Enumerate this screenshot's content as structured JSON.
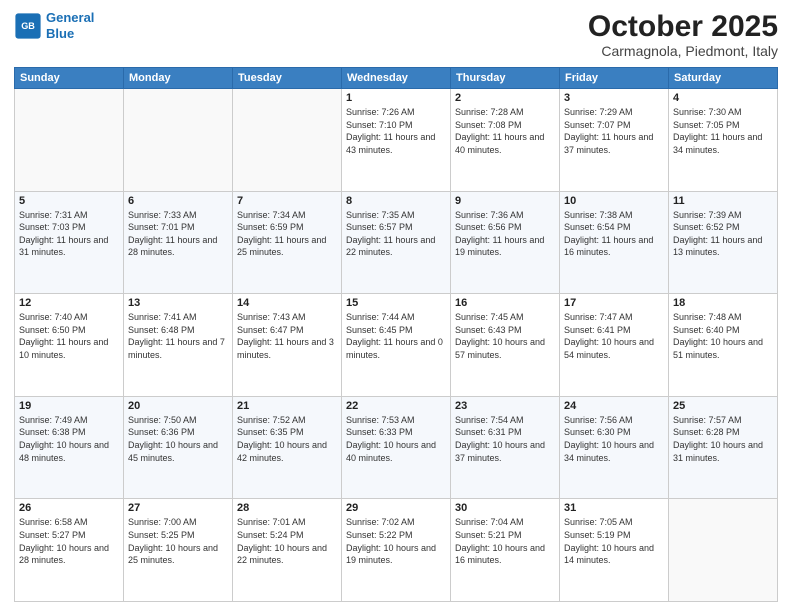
{
  "header": {
    "logo_line1": "General",
    "logo_line2": "Blue",
    "month": "October 2025",
    "location": "Carmagnola, Piedmont, Italy"
  },
  "days_of_week": [
    "Sunday",
    "Monday",
    "Tuesday",
    "Wednesday",
    "Thursday",
    "Friday",
    "Saturday"
  ],
  "weeks": [
    [
      {
        "day": "",
        "content": ""
      },
      {
        "day": "",
        "content": ""
      },
      {
        "day": "",
        "content": ""
      },
      {
        "day": "1",
        "content": "Sunrise: 7:26 AM\nSunset: 7:10 PM\nDaylight: 11 hours and 43 minutes."
      },
      {
        "day": "2",
        "content": "Sunrise: 7:28 AM\nSunset: 7:08 PM\nDaylight: 11 hours and 40 minutes."
      },
      {
        "day": "3",
        "content": "Sunrise: 7:29 AM\nSunset: 7:07 PM\nDaylight: 11 hours and 37 minutes."
      },
      {
        "day": "4",
        "content": "Sunrise: 7:30 AM\nSunset: 7:05 PM\nDaylight: 11 hours and 34 minutes."
      }
    ],
    [
      {
        "day": "5",
        "content": "Sunrise: 7:31 AM\nSunset: 7:03 PM\nDaylight: 11 hours and 31 minutes."
      },
      {
        "day": "6",
        "content": "Sunrise: 7:33 AM\nSunset: 7:01 PM\nDaylight: 11 hours and 28 minutes."
      },
      {
        "day": "7",
        "content": "Sunrise: 7:34 AM\nSunset: 6:59 PM\nDaylight: 11 hours and 25 minutes."
      },
      {
        "day": "8",
        "content": "Sunrise: 7:35 AM\nSunset: 6:57 PM\nDaylight: 11 hours and 22 minutes."
      },
      {
        "day": "9",
        "content": "Sunrise: 7:36 AM\nSunset: 6:56 PM\nDaylight: 11 hours and 19 minutes."
      },
      {
        "day": "10",
        "content": "Sunrise: 7:38 AM\nSunset: 6:54 PM\nDaylight: 11 hours and 16 minutes."
      },
      {
        "day": "11",
        "content": "Sunrise: 7:39 AM\nSunset: 6:52 PM\nDaylight: 11 hours and 13 minutes."
      }
    ],
    [
      {
        "day": "12",
        "content": "Sunrise: 7:40 AM\nSunset: 6:50 PM\nDaylight: 11 hours and 10 minutes."
      },
      {
        "day": "13",
        "content": "Sunrise: 7:41 AM\nSunset: 6:48 PM\nDaylight: 11 hours and 7 minutes."
      },
      {
        "day": "14",
        "content": "Sunrise: 7:43 AM\nSunset: 6:47 PM\nDaylight: 11 hours and 3 minutes."
      },
      {
        "day": "15",
        "content": "Sunrise: 7:44 AM\nSunset: 6:45 PM\nDaylight: 11 hours and 0 minutes."
      },
      {
        "day": "16",
        "content": "Sunrise: 7:45 AM\nSunset: 6:43 PM\nDaylight: 10 hours and 57 minutes."
      },
      {
        "day": "17",
        "content": "Sunrise: 7:47 AM\nSunset: 6:41 PM\nDaylight: 10 hours and 54 minutes."
      },
      {
        "day": "18",
        "content": "Sunrise: 7:48 AM\nSunset: 6:40 PM\nDaylight: 10 hours and 51 minutes."
      }
    ],
    [
      {
        "day": "19",
        "content": "Sunrise: 7:49 AM\nSunset: 6:38 PM\nDaylight: 10 hours and 48 minutes."
      },
      {
        "day": "20",
        "content": "Sunrise: 7:50 AM\nSunset: 6:36 PM\nDaylight: 10 hours and 45 minutes."
      },
      {
        "day": "21",
        "content": "Sunrise: 7:52 AM\nSunset: 6:35 PM\nDaylight: 10 hours and 42 minutes."
      },
      {
        "day": "22",
        "content": "Sunrise: 7:53 AM\nSunset: 6:33 PM\nDaylight: 10 hours and 40 minutes."
      },
      {
        "day": "23",
        "content": "Sunrise: 7:54 AM\nSunset: 6:31 PM\nDaylight: 10 hours and 37 minutes."
      },
      {
        "day": "24",
        "content": "Sunrise: 7:56 AM\nSunset: 6:30 PM\nDaylight: 10 hours and 34 minutes."
      },
      {
        "day": "25",
        "content": "Sunrise: 7:57 AM\nSunset: 6:28 PM\nDaylight: 10 hours and 31 minutes."
      }
    ],
    [
      {
        "day": "26",
        "content": "Sunrise: 6:58 AM\nSunset: 5:27 PM\nDaylight: 10 hours and 28 minutes."
      },
      {
        "day": "27",
        "content": "Sunrise: 7:00 AM\nSunset: 5:25 PM\nDaylight: 10 hours and 25 minutes."
      },
      {
        "day": "28",
        "content": "Sunrise: 7:01 AM\nSunset: 5:24 PM\nDaylight: 10 hours and 22 minutes."
      },
      {
        "day": "29",
        "content": "Sunrise: 7:02 AM\nSunset: 5:22 PM\nDaylight: 10 hours and 19 minutes."
      },
      {
        "day": "30",
        "content": "Sunrise: 7:04 AM\nSunset: 5:21 PM\nDaylight: 10 hours and 16 minutes."
      },
      {
        "day": "31",
        "content": "Sunrise: 7:05 AM\nSunset: 5:19 PM\nDaylight: 10 hours and 14 minutes."
      },
      {
        "day": "",
        "content": ""
      }
    ]
  ]
}
